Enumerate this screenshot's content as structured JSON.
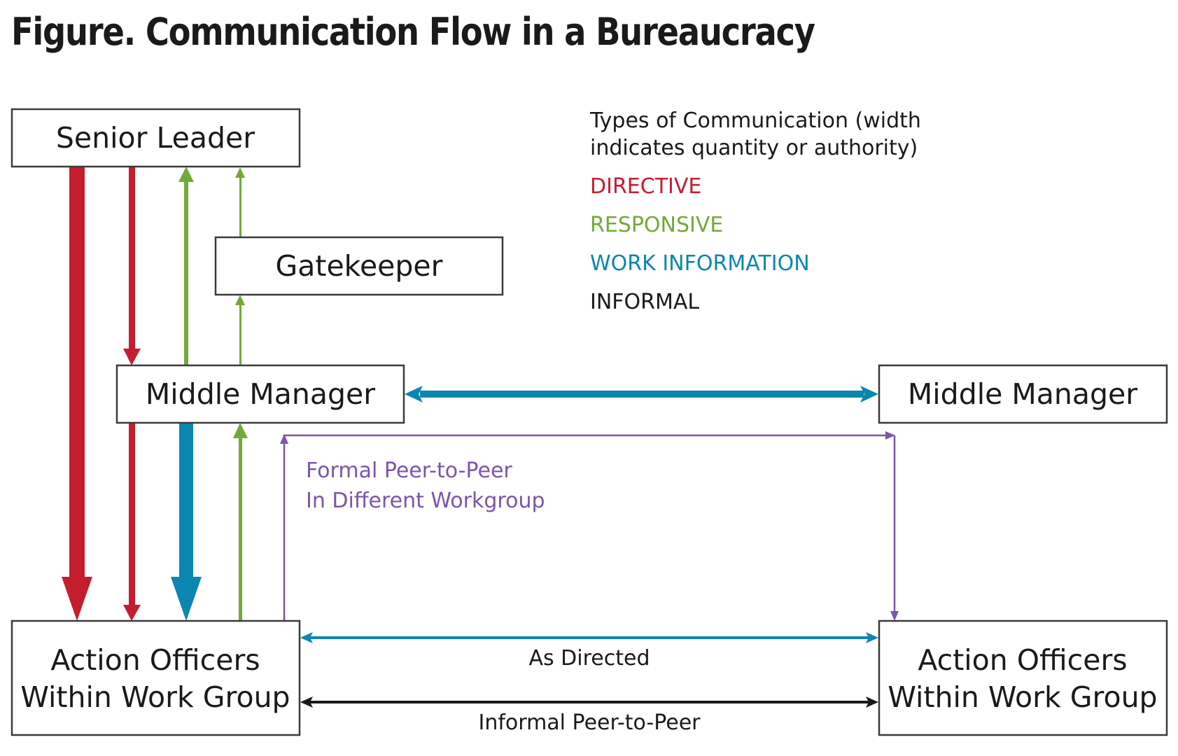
{
  "title": "Figure. Communication Flow in a Bureaucracy",
  "colors": {
    "directive": "#c41e2e",
    "responsive": "#73a939",
    "work_information": "#0b86b0",
    "informal": "#1a1a1a",
    "formal_peer": "#7c55aa"
  },
  "nodes": {
    "senior_leader": "Senior Leader",
    "gatekeeper": "Gatekeeper",
    "middle_manager_left": "Middle Manager",
    "middle_manager_right": "Middle Manager",
    "action_officers_left": [
      "Action Officers",
      "Within Work Group"
    ],
    "action_officers_right": [
      "Action Officers",
      "Within Work Group"
    ]
  },
  "legend": {
    "heading": [
      "Types of Communication (width",
      "indicates quantity or authority)"
    ],
    "items": [
      {
        "label": "DIRECTIVE",
        "type": "directive"
      },
      {
        "label": "RESPONSIVE",
        "type": "responsive"
      },
      {
        "label": "WORK INFORMATION",
        "type": "work_information"
      },
      {
        "label": "INFORMAL",
        "type": "informal"
      }
    ]
  },
  "edges": [
    {
      "from": "Senior Leader",
      "to": "Action Officers (left)",
      "type": "directive",
      "weight": "heavy"
    },
    {
      "from": "Senior Leader",
      "to": "Middle Manager (left)",
      "type": "directive",
      "weight": "medium"
    },
    {
      "from": "Middle Manager (left)",
      "to": "Action Officers (left)",
      "type": "directive",
      "weight": "medium"
    },
    {
      "from": "Middle Manager (left)",
      "to": "Senior Leader",
      "type": "responsive",
      "weight": "medium"
    },
    {
      "from": "Middle Manager (left)",
      "to": "Gatekeeper",
      "type": "responsive",
      "weight": "light"
    },
    {
      "from": "Gatekeeper",
      "to": "Senior Leader",
      "type": "responsive",
      "weight": "light"
    },
    {
      "from": "Middle Manager (left)",
      "to": "Action Officers (left)",
      "type": "work_information",
      "weight": "heavy"
    },
    {
      "from": "Action Officers (left)",
      "to": "Middle Manager (left)",
      "type": "responsive",
      "weight": "medium"
    },
    {
      "from": "Middle Manager (left)",
      "to": "Middle Manager (right)",
      "type": "work_information",
      "weight": "medium",
      "bidirectional": true
    },
    {
      "from": "Action Officers (left)",
      "to": "Action Officers (right)",
      "type": "formal_peer",
      "weight": "light",
      "label": [
        "Formal Peer-to-Peer",
        "In Different Workgroup"
      ]
    },
    {
      "from": "Action Officers (left)",
      "to": "Action Officers (right)",
      "type": "work_information",
      "weight": "light",
      "bidirectional": true,
      "label": "As Directed"
    },
    {
      "from": "Action Officers (left)",
      "to": "Action Officers (right)",
      "type": "informal",
      "weight": "light",
      "bidirectional": true,
      "label": "Informal Peer-to-Peer"
    }
  ],
  "labels": {
    "formal_peer": [
      "Formal Peer-to-Peer",
      "In Different Workgroup"
    ],
    "as_directed": "As Directed",
    "informal_peer": "Informal Peer-to-Peer"
  }
}
